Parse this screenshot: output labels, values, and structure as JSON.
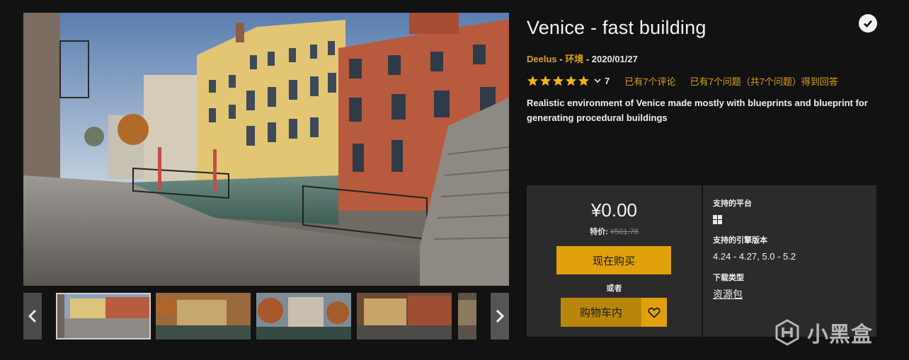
{
  "product": {
    "title": "Venice - fast building",
    "seller": "Deelus",
    "sep1": " - ",
    "category": "环境",
    "sep2": " - ",
    "date": "2020/01/27",
    "rating_count": "7",
    "rating_stars": 5,
    "reviews_link": "已有7个评论",
    "questions_link": "已有7个问题（共7个问题）得到回答",
    "description": "Realistic environment of Venice made mostly with blueprints and blueprint for generating procedural buildings"
  },
  "purchase": {
    "price": "¥0.00",
    "sale_label": "特价:",
    "original_price": "¥501.78",
    "buy_now": "现在购买",
    "or": "或者",
    "add_to_cart": "购物车内"
  },
  "specs": {
    "platforms_label": "支持的平台",
    "platform_icon": "windows-icon",
    "engine_label": "支持的引擎版本",
    "engine_versions": "4.24 - 4.27, 5.0 - 5.2",
    "download_label": "下载类型",
    "download_type": "资源包"
  },
  "gallery": {
    "thumbnail_count": 5,
    "active_index": 0
  },
  "watermark": {
    "text": "小黑盒"
  },
  "colors": {
    "accent": "#e0a10a",
    "link": "#d9a21b",
    "background": "#121212",
    "panel": "#2b2b2b"
  }
}
